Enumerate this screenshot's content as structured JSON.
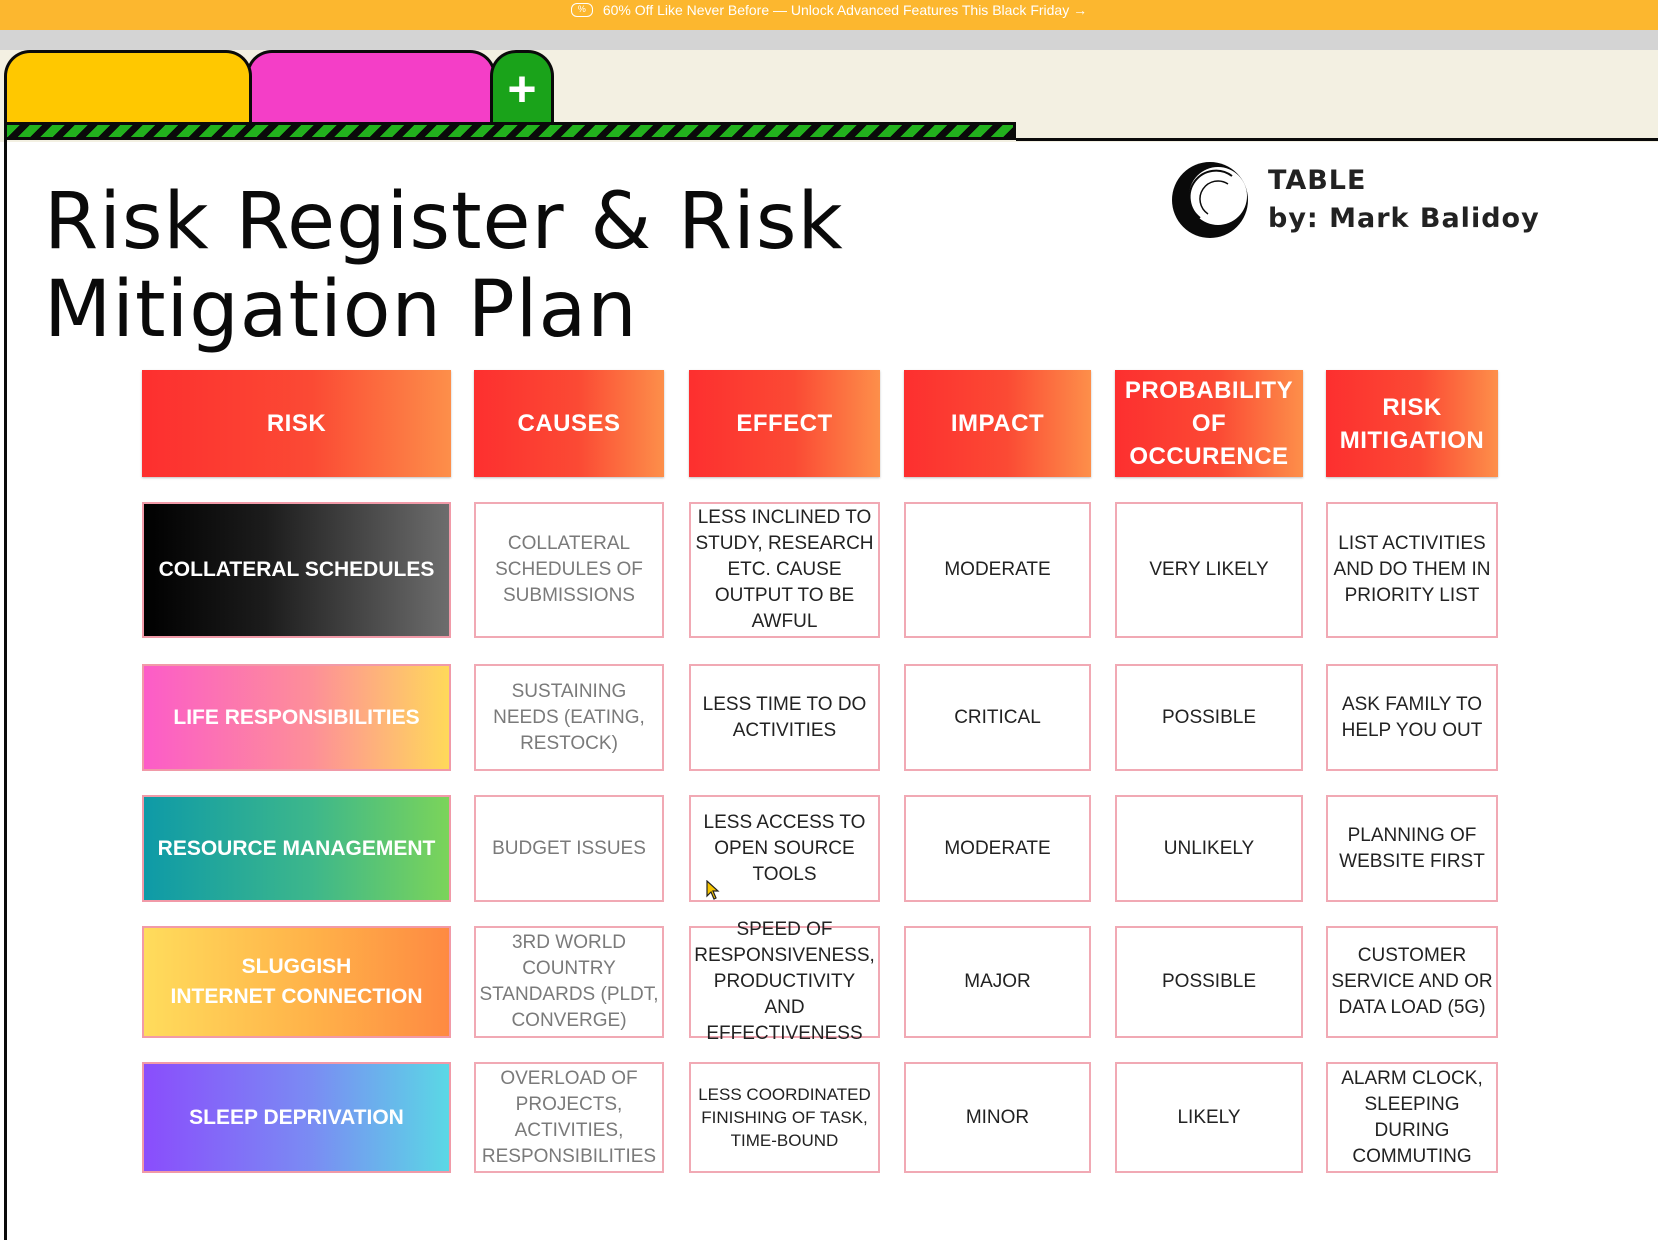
{
  "promo": {
    "icon_text": "%",
    "text": "60% Off Like Never Before — Unlock Advanced Features This Black Friday →"
  },
  "tabs": {
    "add_symbol": "+"
  },
  "page": {
    "title_line1": "Risk Register & Risk",
    "title_line2": "Mitigation Plan",
    "brand_line1": "TABLE",
    "brand_line2": "by: Mark Balidoy"
  },
  "table": {
    "headers": {
      "risk": [
        "RISK"
      ],
      "causes": [
        "CAUSES"
      ],
      "effect": [
        "EFFECT"
      ],
      "impact": [
        "IMPACT"
      ],
      "probability": [
        "PROBABILITY",
        "OF",
        "OCCURENCE"
      ],
      "mitigation": [
        "RISK",
        "MITIGATION"
      ]
    },
    "rows": [
      {
        "risk": [
          "COLLATERAL SCHEDULES"
        ],
        "causes": [
          "COLLATERAL",
          "SCHEDULES OF",
          "SUBMISSIONS"
        ],
        "effect": [
          "LESS INCLINED TO",
          "STUDY, RESEARCH",
          "ETC. CAUSE",
          "OUTPUT TO BE",
          "AWFUL"
        ],
        "impact": [
          "MODERATE"
        ],
        "probability": [
          "VERY LIKELY"
        ],
        "mitigation": [
          "LIST ACTIVITIES",
          "AND DO THEM IN",
          "PRIORITY LIST"
        ]
      },
      {
        "risk": [
          "LIFE RESPONSIBILITIES"
        ],
        "causes": [
          "SUSTAINING",
          "NEEDS (EATING,",
          "RESTOCK)"
        ],
        "effect": [
          "LESS TIME TO DO",
          "ACTIVITIES"
        ],
        "impact": [
          "CRITICAL"
        ],
        "probability": [
          "POSSIBLE"
        ],
        "mitigation": [
          "ASK FAMILY TO",
          "HELP YOU OUT"
        ]
      },
      {
        "risk": [
          "RESOURCE MANAGEMENT"
        ],
        "causes": [
          "BUDGET ISSUES"
        ],
        "effect": [
          "LESS ACCESS TO",
          "OPEN SOURCE",
          "TOOLS"
        ],
        "impact": [
          "MODERATE"
        ],
        "probability": [
          "UNLIKELY"
        ],
        "mitigation": [
          "PLANNING OF",
          "WEBSITE FIRST"
        ]
      },
      {
        "risk": [
          "SLUGGISH",
          "INTERNET CONNECTION"
        ],
        "causes": [
          "3RD WORLD",
          "COUNTRY",
          "STANDARDS (PLDT,",
          "CONVERGE)"
        ],
        "effect": [
          "SPEED OF",
          "RESPONSIVENESS,",
          "PRODUCTIVITY AND",
          "EFFECTIVENESS"
        ],
        "impact": [
          "MAJOR"
        ],
        "probability": [
          "POSSIBLE"
        ],
        "mitigation": [
          "CUSTOMER",
          "SERVICE AND OR",
          "DATA LOAD (5G)"
        ]
      },
      {
        "risk": [
          "SLEEP DEPRIVATION"
        ],
        "causes": [
          "OVERLOAD OF",
          "PROJECTS,",
          "ACTIVITIES,",
          "RESPONSIBILITIES"
        ],
        "effect": [
          "LESS COORDINATED",
          "FINISHING OF TASK,",
          "TIME-BOUND"
        ],
        "impact": [
          "MINOR"
        ],
        "probability": [
          "LIKELY"
        ],
        "mitigation": [
          "ALARM CLOCK,",
          "SLEEPING",
          "DURING",
          "COMMUTING"
        ]
      }
    ]
  }
}
